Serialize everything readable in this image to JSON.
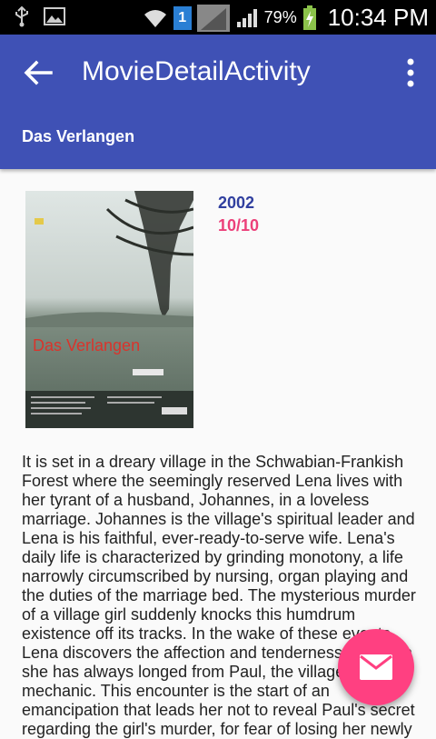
{
  "status_bar": {
    "battery": "79%",
    "time": "10:34 PM",
    "sim_badge": "1"
  },
  "toolbar": {
    "title": "MovieDetailActivity",
    "subtitle": "Das Verlangen"
  },
  "movie": {
    "poster_title": "Das Verlangen",
    "year": "2002",
    "rating": "10/10",
    "overview": "It is set in a dreary village in the Schwabian-Frankish Forest where the seemingly reserved Lena lives with her tyrant of a husband, Johannes, in a loveless marriage. Johannes is the village's spiritual leader and Lena is his faithful, ever-ready-to-serve wife. Lena's daily life is characterized by grinding monotony, a life narrowly circumscribed by nursing, organ playing and the duties of the marriage bed. The mysterious murder of a village girl suddenly knocks this humdrum existence off its tracks. In the wake of these events Lena discovers the affection and tenderness for which she has always longed from Paul, the village mechanic. This encounter is the start of an emancipation that leads her not to reveal Paul's secret regarding the girl's murder, for fear of losing her newly"
  },
  "colors": {
    "primary": "#3f51b5",
    "accent": "#ff4081",
    "year": "#303f9f",
    "rating": "#ec407a"
  },
  "icons": {
    "back": "arrow-back-icon",
    "menu": "more-vert-icon",
    "fab": "email-icon"
  }
}
